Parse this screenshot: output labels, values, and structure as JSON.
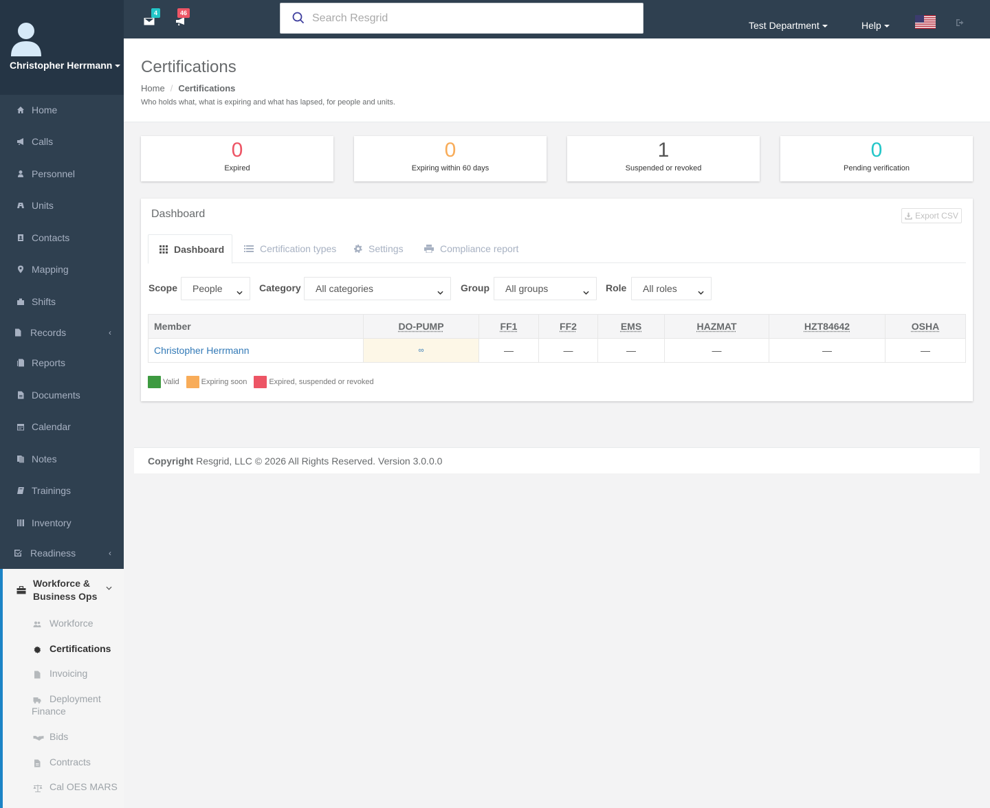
{
  "user": {
    "name": "Christopher Herrmann"
  },
  "sidebar": {
    "items": [
      {
        "label": "Home",
        "icon": "home-icon"
      },
      {
        "label": "Calls",
        "icon": "bullhorn-icon"
      },
      {
        "label": "Personnel",
        "icon": "user-icon"
      },
      {
        "label": "Units",
        "icon": "truck-icon"
      },
      {
        "label": "Contacts",
        "icon": "address-book-icon"
      },
      {
        "label": "Mapping",
        "icon": "map-marker-icon"
      },
      {
        "label": "Shifts",
        "icon": "shifts-icon"
      },
      {
        "label": "Records",
        "icon": "file-icon",
        "expand": "‹"
      },
      {
        "label": "Reports",
        "icon": "reports-icon"
      },
      {
        "label": "Documents",
        "icon": "document-icon"
      },
      {
        "label": "Calendar",
        "icon": "calendar-icon"
      },
      {
        "label": "Notes",
        "icon": "notes-icon"
      },
      {
        "label": "Trainings",
        "icon": "book-icon"
      },
      {
        "label": "Inventory",
        "icon": "barcode-icon"
      },
      {
        "label": "Readiness",
        "icon": "check-square-icon",
        "expand": "‹"
      }
    ],
    "workforce_group": {
      "label_line1": "Workforce &",
      "label_line2": "Business Ops",
      "icon": "briefcase-icon",
      "children": [
        {
          "label": "Workforce",
          "icon": "users-icon"
        },
        {
          "label": "Certifications",
          "icon": "certificate-icon",
          "active": true
        },
        {
          "label": "Invoicing",
          "icon": "invoice-icon"
        },
        {
          "label_line1": "Deployment",
          "label_line2": "Finance",
          "icon": "truck-icon"
        },
        {
          "label": "Bids",
          "icon": "handshake-icon"
        },
        {
          "label": "Contracts",
          "icon": "contract-icon"
        },
        {
          "label": "Cal OES MARS",
          "icon": "balance-scale-icon"
        }
      ]
    }
  },
  "topbar": {
    "messages_count": "4",
    "calls_count": "46",
    "search_placeholder": "Search Resgrid",
    "department": "Test Department",
    "help": "Help",
    "colors": {
      "bg": "#2f4050",
      "msg_badge": "#23c6c8",
      "call_badge": "#ed5565"
    }
  },
  "page": {
    "title": "Certifications",
    "breadcrumb": [
      "Home",
      "Certifications"
    ],
    "subtitle": "Who holds what, what is expiring and what has lapsed, for people and units."
  },
  "stats": [
    {
      "value": "0",
      "label": "Expired",
      "color": "#ed5565"
    },
    {
      "value": "0",
      "label": "Expiring within 60 days",
      "color": "#f8ac59"
    },
    {
      "value": "1",
      "label": "Suspended or revoked",
      "color": "#555555"
    },
    {
      "value": "0",
      "label": "Pending verification",
      "color": "#23c6c8"
    }
  ],
  "panel": {
    "title": "Dashboard",
    "export_label": "Export CSV",
    "tabs": [
      {
        "label": "Dashboard",
        "icon": "grid-icon",
        "active": true
      },
      {
        "label": "Certification types",
        "icon": "list-icon"
      },
      {
        "label": "Settings",
        "icon": "gear-icon"
      },
      {
        "label": "Compliance report",
        "icon": "print-icon"
      }
    ],
    "filters": {
      "scope": {
        "label": "Scope",
        "value": "People"
      },
      "category": {
        "label": "Category",
        "value": "All categories"
      },
      "group": {
        "label": "Group",
        "value": "All groups"
      },
      "role": {
        "label": "Role",
        "value": "All roles"
      }
    },
    "table": {
      "columns": [
        "Member",
        "DO-PUMP",
        "FF1",
        "FF2",
        "EMS",
        "HAZMAT",
        "HZT84642",
        "OSHA"
      ],
      "rows": [
        {
          "member": "Christopher Herrmann",
          "cells": [
            "∞",
            "—",
            "—",
            "—",
            "—",
            "—",
            "—"
          ]
        }
      ]
    },
    "legend": [
      {
        "label": "Valid",
        "color": "#3d9a40"
      },
      {
        "label": "Expiring soon",
        "color": "#f8ac59"
      },
      {
        "label": "Expired, suspended or revoked",
        "color": "#ed5565"
      }
    ]
  },
  "footer": {
    "copyright": "Copyright",
    "text": "Resgrid, LLC © 2026 All Rights Reserved.",
    "version": "Version 3.0.0.0"
  }
}
